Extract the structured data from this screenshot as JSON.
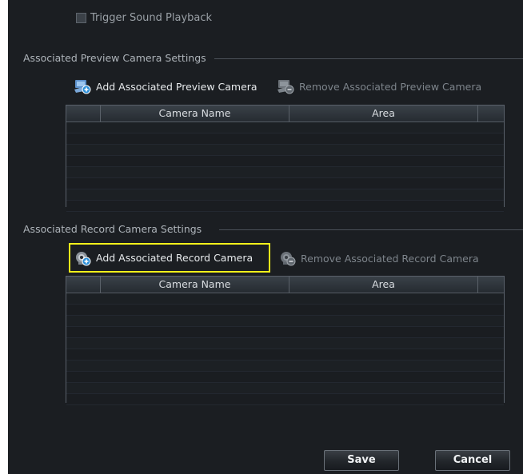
{
  "trigger_sound": {
    "label": "Trigger Sound Playback",
    "checked": false
  },
  "preview_section": {
    "title": "Associated Preview Camera Settings",
    "add_button": "Add Associated Preview Camera",
    "remove_button": "Remove Associated Preview Camera",
    "columns": [
      "",
      "Camera Name",
      "Area",
      ""
    ]
  },
  "record_section": {
    "title": "Associated Record  Camera Settings",
    "add_button": "Add Associated Record  Camera",
    "remove_button": "Remove Associated Record  Camera",
    "columns": [
      "",
      "Camera Name",
      "Area",
      ""
    ]
  },
  "footer": {
    "save_label": "Save",
    "cancel_label": "Cancel"
  },
  "colors": {
    "panel_bg": "#1b1e22",
    "highlight": "#f4f11a",
    "text": "#e7eaec",
    "disabled_text": "#7d848b"
  }
}
